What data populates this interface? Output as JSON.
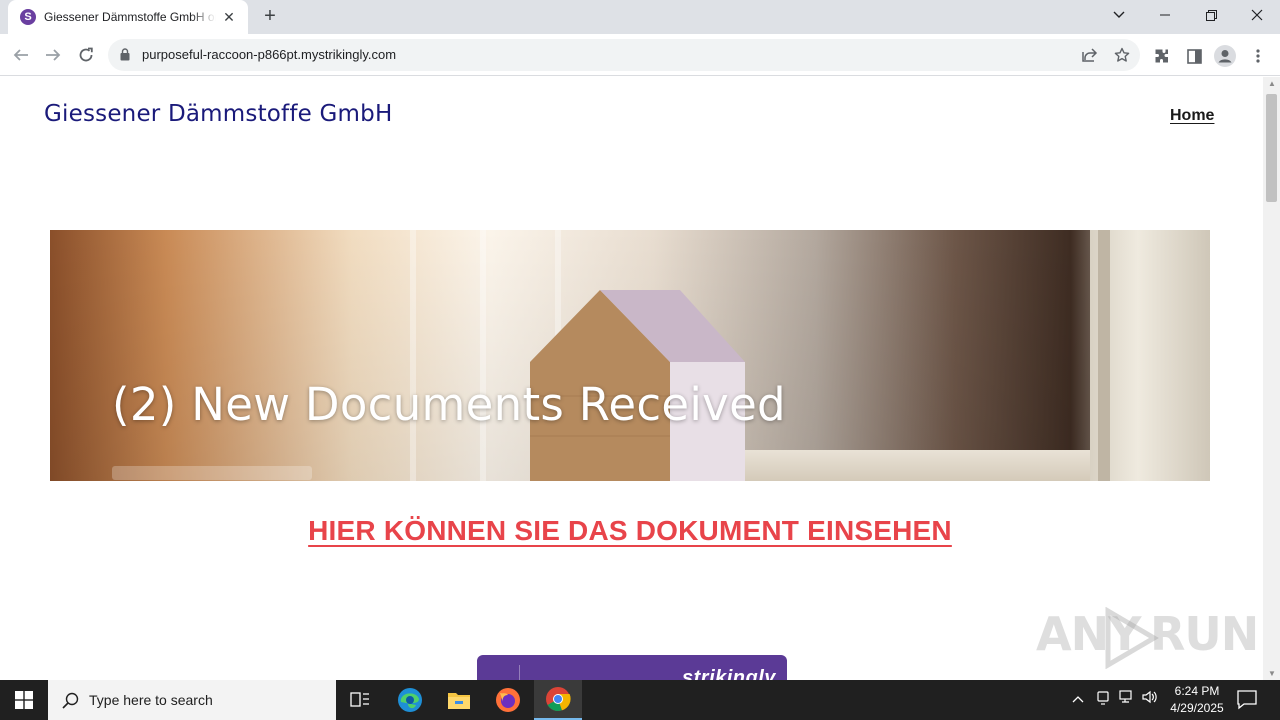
{
  "browser": {
    "tab_title": "Giessener Dämmstoffe GmbH on",
    "favicon_letter": "S",
    "url": "purposeful-raccoon-p866pt.mystrikingly.com"
  },
  "site": {
    "title": "Giessener Dämmstoffe GmbH",
    "nav_home": "Home",
    "hero_text": "(2) New Documents Received",
    "document_link": "HIER KÖNNEN SIE DAS DOKUMENT EINSEHEN",
    "badge_text": "strikingly"
  },
  "watermark": {
    "left": "ANY",
    "right": "RUN"
  },
  "taskbar": {
    "search_placeholder": "Type here to search",
    "time": "6:24 PM",
    "date": "4/29/2025"
  },
  "colors": {
    "site_title": "#1a1a7a",
    "link_red": "#e8444a",
    "strikingly_purple": "#5b3a96"
  }
}
